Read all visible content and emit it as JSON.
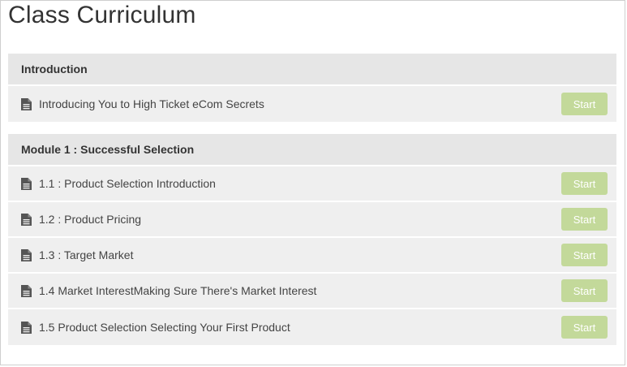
{
  "page": {
    "title": "Class Curriculum"
  },
  "sections": [
    {
      "title": "Introduction",
      "lessons": [
        {
          "title": "Introducing You to High Ticket eCom Secrets",
          "button": "Start",
          "icon": "document-icon"
        }
      ]
    },
    {
      "title": "Module 1 : Successful Selection",
      "lessons": [
        {
          "title": "1.1 : Product Selection Introduction",
          "button": "Start",
          "icon": "document-icon"
        },
        {
          "title": "1.2 : Product Pricing",
          "button": "Start",
          "icon": "document-icon"
        },
        {
          "title": "1.3 : Target Market",
          "button": "Start",
          "icon": "document-icon"
        },
        {
          "title": "1.4 Market InterestMaking Sure There's Market Interest",
          "button": "Start",
          "icon": "document-icon"
        },
        {
          "title": "1.5 Product Selection Selecting Your First Product",
          "button": "Start",
          "icon": "document-icon"
        }
      ]
    }
  ],
  "colors": {
    "section_header_bg": "#e6e6e6",
    "row_bg": "#efefef",
    "start_button_bg": "#c3d99a"
  }
}
